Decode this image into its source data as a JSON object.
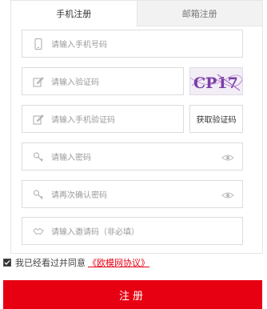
{
  "tabs": [
    {
      "label": "手机注册",
      "active": true
    },
    {
      "label": "邮箱注册",
      "active": false
    }
  ],
  "form": {
    "phone_placeholder": "请输入手机号码",
    "captcha_placeholder": "请输入验证码",
    "sms_placeholder": "请输入手机验证码",
    "password_placeholder": "请输入密码",
    "password_confirm_placeholder": "请再次确认密码",
    "invite_placeholder": "请输入邀请码（非必填）",
    "get_code_label": "获取验证码",
    "captcha_text": "CP17"
  },
  "agreement": {
    "text": "我已经看过并同意",
    "link": "《欧模网协议》",
    "checked": true
  },
  "submit_label": "注册",
  "colors": {
    "accent": "#e60012",
    "border": "#dcdcdc",
    "placeholder": "#9a9a9a"
  },
  "icons": [
    "phone-icon",
    "edit-icon",
    "key-icon",
    "eye-icon",
    "handshake-icon"
  ]
}
